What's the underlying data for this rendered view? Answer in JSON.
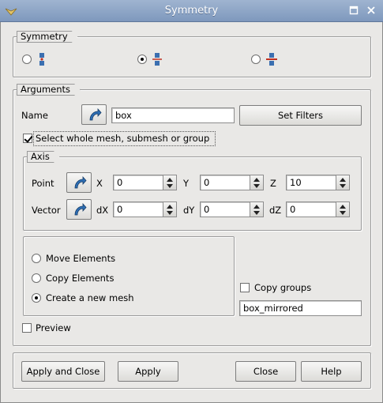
{
  "window": {
    "title": "Symmetry"
  },
  "symmetry": {
    "group_title": "Symmetry",
    "options": [
      {
        "icon": "point-symmetry-icon",
        "selected": false
      },
      {
        "icon": "axis-symmetry-icon",
        "selected": true
      },
      {
        "icon": "plane-symmetry-icon",
        "selected": false
      }
    ]
  },
  "arguments": {
    "group_title": "Arguments",
    "name_label": "Name",
    "name_value": "box",
    "set_filters_label": "Set Filters",
    "whole_mesh_label": "Select whole mesh, submesh or group",
    "whole_mesh_checked": true
  },
  "axis": {
    "group_title": "Axis",
    "point_label": "Point",
    "vector_label": "Vector",
    "point": {
      "x_label": "X",
      "x": "0",
      "y_label": "Y",
      "y": "0",
      "z_label": "Z",
      "z": "10"
    },
    "vector": {
      "dx_label": "dX",
      "dx": "0",
      "dy_label": "dY",
      "dy": "0",
      "dz_label": "dZ",
      "dz": "0"
    }
  },
  "action": {
    "move_label": "Move Elements",
    "copy_label": "Copy Elements",
    "new_mesh_label": "Create a new mesh",
    "selected": "new_mesh"
  },
  "copy_groups": {
    "label": "Copy groups",
    "checked": false
  },
  "new_mesh_name": "box_mirrored",
  "preview": {
    "label": "Preview",
    "checked": false
  },
  "footer": {
    "apply_close_label": "Apply and Close",
    "apply_label": "Apply",
    "close_label": "Close",
    "help_label": "Help"
  }
}
